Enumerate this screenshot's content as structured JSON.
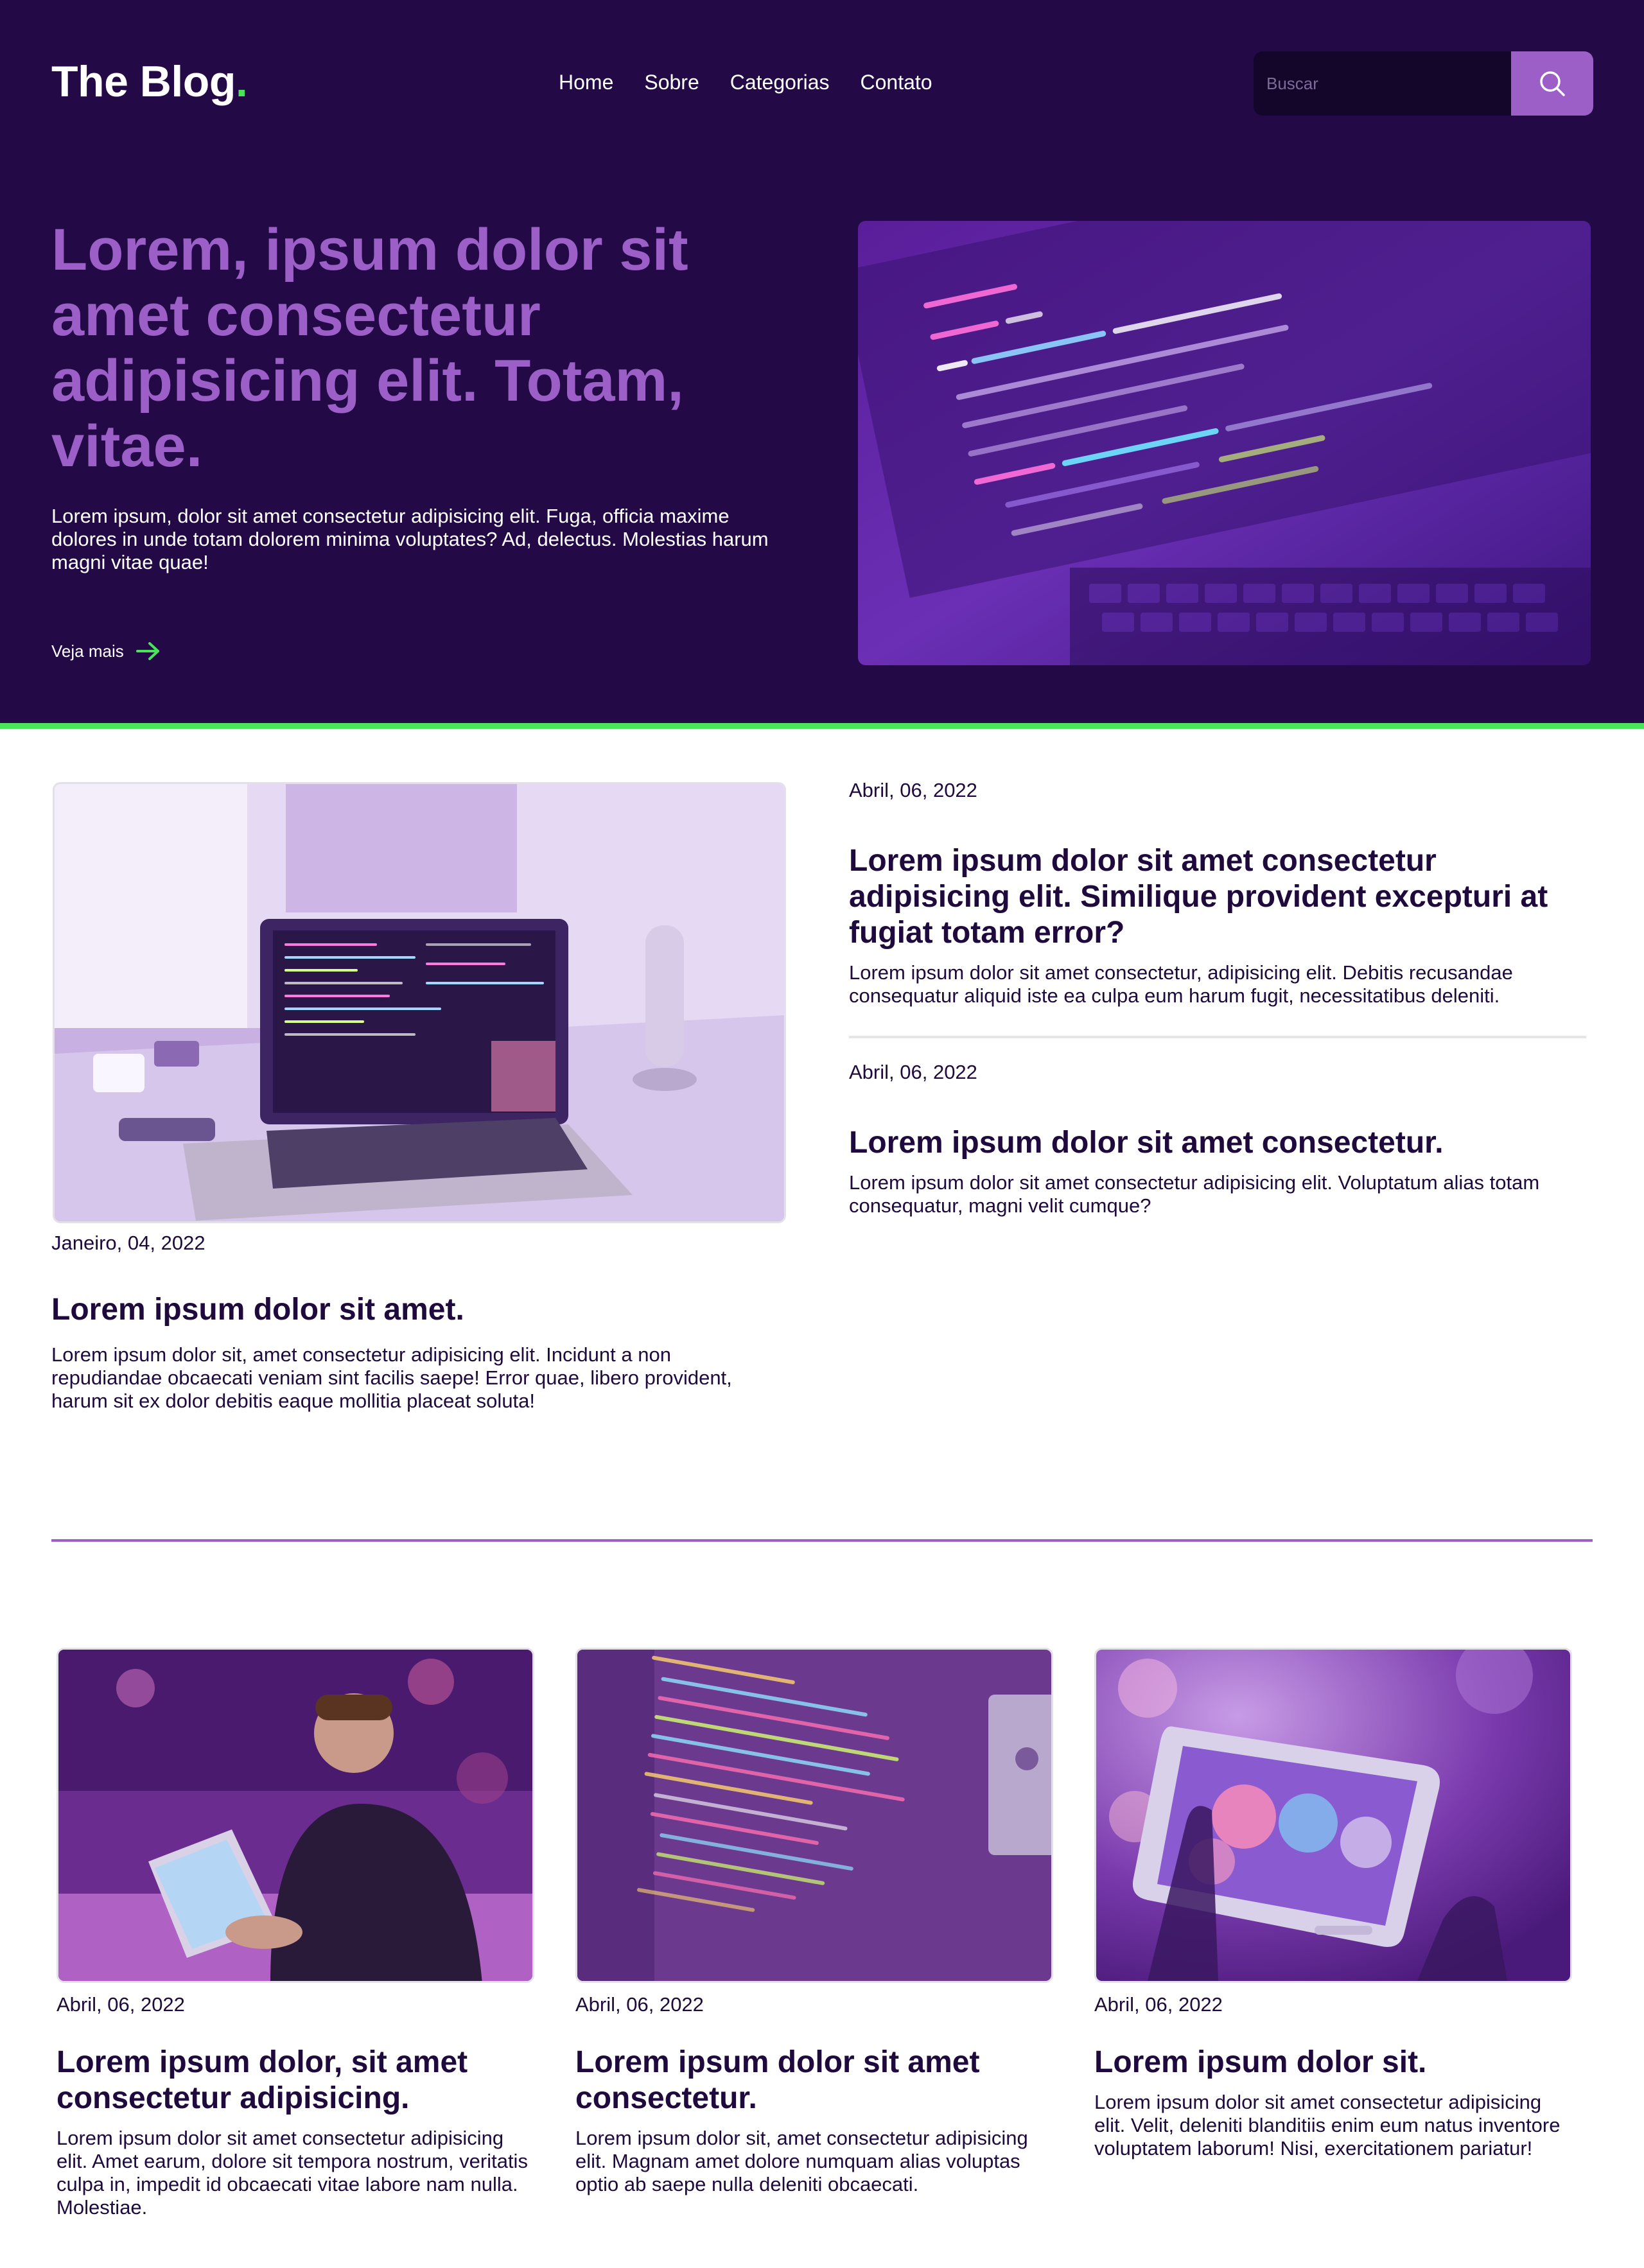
{
  "brand": {
    "name": "The Blog",
    "dot": ".",
    "accent": "#48e55a",
    "primary": "#9b5fc7",
    "dark_bg": "#230a46"
  },
  "nav": {
    "items": [
      "Home",
      "Sobre",
      "Categorias",
      "Contato"
    ]
  },
  "search": {
    "placeholder": "Buscar",
    "icon": "search-icon"
  },
  "hero": {
    "title": "Lorem, ipsum dolor sit amet consectetur adipisicing elit. Totam, vitae.",
    "text": "Lorem ipsum, dolor sit amet consectetur adipisicing elit. Fuga, officia maxime dolores in unde totam dolorem minima voluptates? Ad, delectus. Molestias harum magni vitae quae!",
    "link_label": "Veja mais",
    "link_icon": "arrow-right-icon",
    "image": "code-on-laptop-screen"
  },
  "featured": {
    "image": "laptop-on-desk",
    "date": "Janeiro, 04, 2022",
    "title": "Lorem ipsum dolor sit amet.",
    "text": "Lorem ipsum dolor sit, amet consectetur adipisicing elit. Incidunt a non repudiandae obcaecati veniam sint facilis saepe! Error quae, libero provident, harum sit ex dolor debitis eaque mollitia placeat soluta!"
  },
  "side_posts": [
    {
      "date": "Abril, 06, 2022",
      "title": "Lorem ipsum dolor sit amet consectetur adipisicing elit. Similique provident excepturi at fugiat totam error?",
      "text": "Lorem ipsum dolor sit amet consectetur, adipisicing elit. Debitis recusandae consequatur aliquid iste ea culpa eum harum fugit, necessitatibus deleniti."
    },
    {
      "date": "Abril, 06, 2022",
      "title": "Lorem ipsum dolor sit amet consectetur.",
      "text": "Lorem ipsum dolor sit amet consectetur adipisicing elit. Voluptatum alias totam consequatur, magni velit cumque?"
    }
  ],
  "cards": [
    {
      "image": "man-with-laptop",
      "date": "Abril, 06, 2022",
      "title": "Lorem ipsum dolor, sit amet consectetur adipisicing.",
      "text": "Lorem ipsum dolor sit amet consectetur adipisicing elit. Amet earum, dolore sit tempora nostrum, veritatis culpa in, impedit id obcaecati vitae labore nam nulla. Molestiae."
    },
    {
      "image": "html-code-screen",
      "date": "Abril, 06, 2022",
      "title": "Lorem ipsum dolor sit amet consectetur.",
      "text": "Lorem ipsum dolor sit, amet consectetur adipisicing elit. Magnam amet dolore numquam alias voluptas optio ab saepe nulla deleniti obcaecati."
    },
    {
      "image": "hand-holding-phone",
      "date": "Abril, 06, 2022",
      "title": "Lorem ipsum dolor sit.",
      "text": "Lorem ipsum dolor sit amet consectetur adipisicing elit. Velit, deleniti blanditiis enim eum natus inventore voluptatem laborum! Nisi, exercitationem pariatur!"
    }
  ]
}
